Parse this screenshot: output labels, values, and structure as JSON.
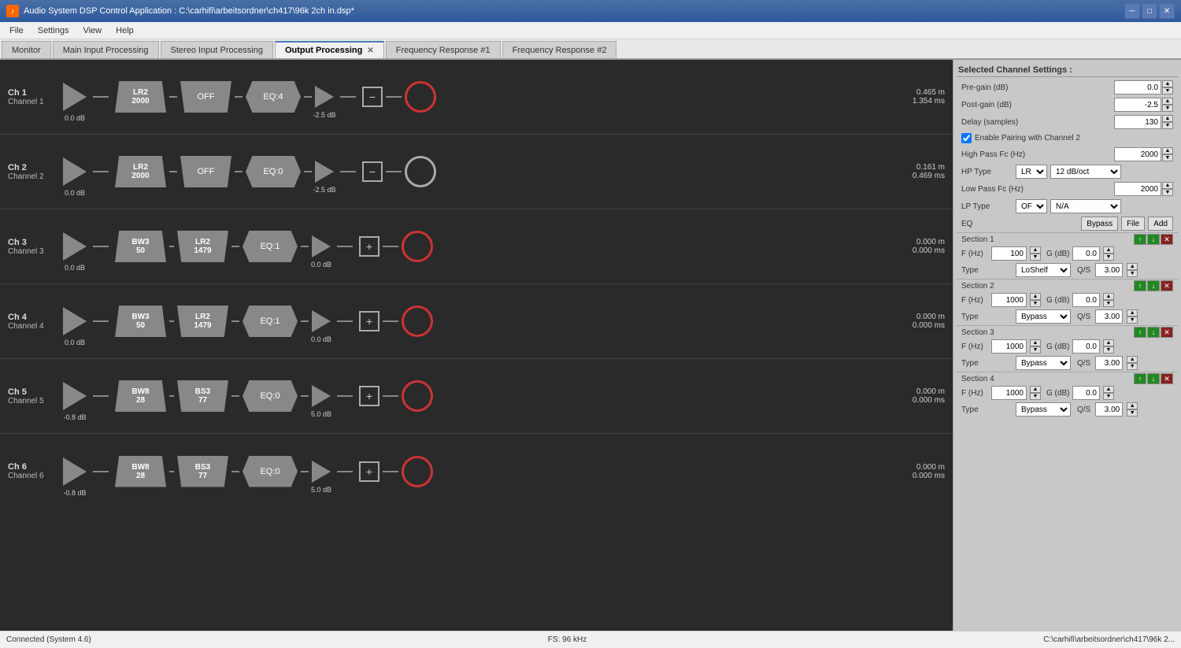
{
  "titleBar": {
    "title": "Audio System DSP Control Application : C:\\carhifi\\arbeitsordner\\ch417\\96k 2ch in.dsp*",
    "icon": "♪",
    "minimizeBtn": "─",
    "maximizeBtn": "□",
    "closeBtn": "✕"
  },
  "menuBar": {
    "items": [
      "File",
      "Settings",
      "View",
      "Help"
    ]
  },
  "tabs": [
    {
      "label": "Monitor",
      "active": false
    },
    {
      "label": "Main Input Processing",
      "active": false
    },
    {
      "label": "Stereo Input Processing",
      "active": false
    },
    {
      "label": "Output Processing",
      "active": true,
      "closeable": true
    },
    {
      "label": "Frequency Response #1",
      "active": false
    },
    {
      "label": "Frequency Response #2",
      "active": false
    }
  ],
  "channels": [
    {
      "name": "Ch 1",
      "sub": "Channel 1",
      "pregain": "0.0 dB",
      "filter1": {
        "line1": "LR2",
        "line2": "2000"
      },
      "filter2": {
        "label": "OFF"
      },
      "eq": "EQ:4",
      "postgain": "-2.5 dB",
      "sumSymbol": "−",
      "outputType": "red",
      "distM": "0.465 m",
      "distMs": "1.354 ms"
    },
    {
      "name": "Ch 2",
      "sub": "Channel 2",
      "pregain": "0.0 dB",
      "filter1": {
        "line1": "LR2",
        "line2": "2000"
      },
      "filter2": {
        "label": "OFF"
      },
      "eq": "EQ:0",
      "postgain": "-2.5 dB",
      "sumSymbol": "−",
      "outputType": "white",
      "distM": "0.161 m",
      "distMs": "0.469 ms"
    },
    {
      "name": "Ch 3",
      "sub": "Channel 3",
      "pregain": "0.0 dB",
      "filter1": {
        "line1": "BW3",
        "line2": "50"
      },
      "filter2": {
        "line1": "LR2",
        "line2": "1479"
      },
      "eq": "EQ:1",
      "postgain": "0.0 dB",
      "sumSymbol": "+",
      "outputType": "red",
      "distM": "0.000 m",
      "distMs": "0.000 ms"
    },
    {
      "name": "Ch 4",
      "sub": "Channel 4",
      "pregain": "0.0 dB",
      "filter1": {
        "line1": "BW3",
        "line2": "50"
      },
      "filter2": {
        "line1": "LR2",
        "line2": "1479"
      },
      "eq": "EQ:1",
      "postgain": "0.0 dB",
      "sumSymbol": "+",
      "outputType": "red",
      "distM": "0.000 m",
      "distMs": "0.000 ms"
    },
    {
      "name": "Ch 5",
      "sub": "Channel 5",
      "pregain": "-0.8 dB",
      "filter1": {
        "line1": "BW8",
        "line2": "28"
      },
      "filter2": {
        "line1": "BS3",
        "line2": "77"
      },
      "eq": "EQ:0",
      "postgain": "5.0 dB",
      "sumSymbol": "+",
      "outputType": "red",
      "distM": "0.000 m",
      "distMs": "0.000 ms"
    },
    {
      "name": "Ch 6",
      "sub": "Channel 6",
      "pregain": "-0.8 dB",
      "filter1": {
        "line1": "BW8",
        "line2": "28"
      },
      "filter2": {
        "line1": "BS3",
        "line2": "77"
      },
      "eq": "EQ:0",
      "postgain": "5.0 dB",
      "sumSymbol": "+",
      "outputType": "red",
      "distM": "0.000 m",
      "distMs": "0.000 ms"
    }
  ],
  "rightPanel": {
    "title": "Selected Channel Settings :",
    "pregainLabel": "Pre-gain (dB)",
    "pregainValue": "0.0",
    "postgainLabel": "Post-gain (dB)",
    "postgainValue": "-2.5",
    "delayLabel": "Delay (samples)",
    "delayValue": "130",
    "enablePairingLabel": "Enable Pairing with Channel 2",
    "hpFcLabel": "High Pass Fc (Hz)",
    "hpFcValue": "2000",
    "hpTypeLabel": "HP Type",
    "hpTypeValue": "LR",
    "hpSlopeValue": "12 dB/oct",
    "lpFcLabel": "Low Pass Fc (Hz)",
    "lpFcValue": "2000",
    "lpTypeLabel": "LP Type",
    "lpTypeValue": "OFF",
    "lpSlopeValue": "N/A",
    "eqLabel": "EQ",
    "eqBypassBtn": "Bypass",
    "eqFileBtn": "File",
    "eqAddBtn": "Add",
    "sections": [
      {
        "label": "Section 1",
        "fHz": "100",
        "gdB": "0.0",
        "type": "LoShelf",
        "qs": "3.00"
      },
      {
        "label": "Section 2",
        "fHz": "1000",
        "gdB": "0.0",
        "type": "Bypass",
        "qs": "3.00"
      },
      {
        "label": "Section 3",
        "fHz": "1000",
        "gdB": "0.0",
        "type": "Bypass",
        "qs": "3.00"
      },
      {
        "label": "Section 4",
        "fHz": "1000",
        "gdB": "0.0",
        "type": "Bypass",
        "qs": "3.00"
      }
    ]
  },
  "statusBar": {
    "connected": "Connected (System 4.6)",
    "fs": "FS: 96 kHz",
    "path": "C:\\carhifi\\arbeitsordner\\ch417\\96k 2..."
  }
}
